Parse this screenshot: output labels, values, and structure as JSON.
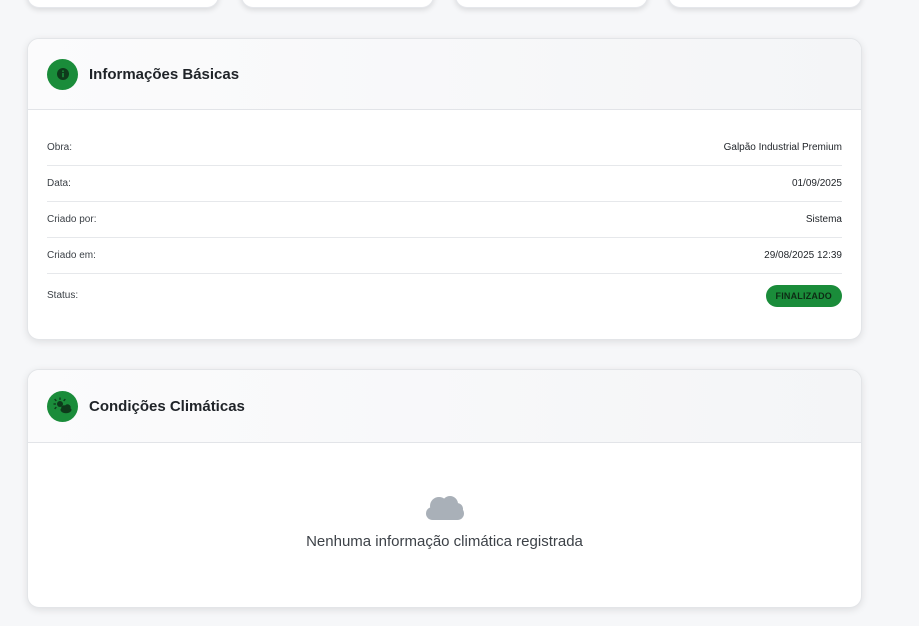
{
  "colors": {
    "accent": "#1a8c3a",
    "icon_gray": "#a9b0b8"
  },
  "basic_info": {
    "icon": "info-icon",
    "title": "Informações Básicas",
    "rows": [
      {
        "label": "Obra:",
        "value": "Galpão Industrial Premium"
      },
      {
        "label": "Data:",
        "value": "01/09/2025"
      },
      {
        "label": "Criado por:",
        "value": "Sistema"
      },
      {
        "label": "Criado em:",
        "value": "29/08/2025 12:39"
      }
    ],
    "status_label": "Status:",
    "status_value": "FINALIZADO"
  },
  "climate": {
    "icon": "sun-cloud-icon",
    "title": "Condições Climáticas",
    "empty_icon": "cloud-icon",
    "empty_text": "Nenhuma informação climática registrada"
  }
}
